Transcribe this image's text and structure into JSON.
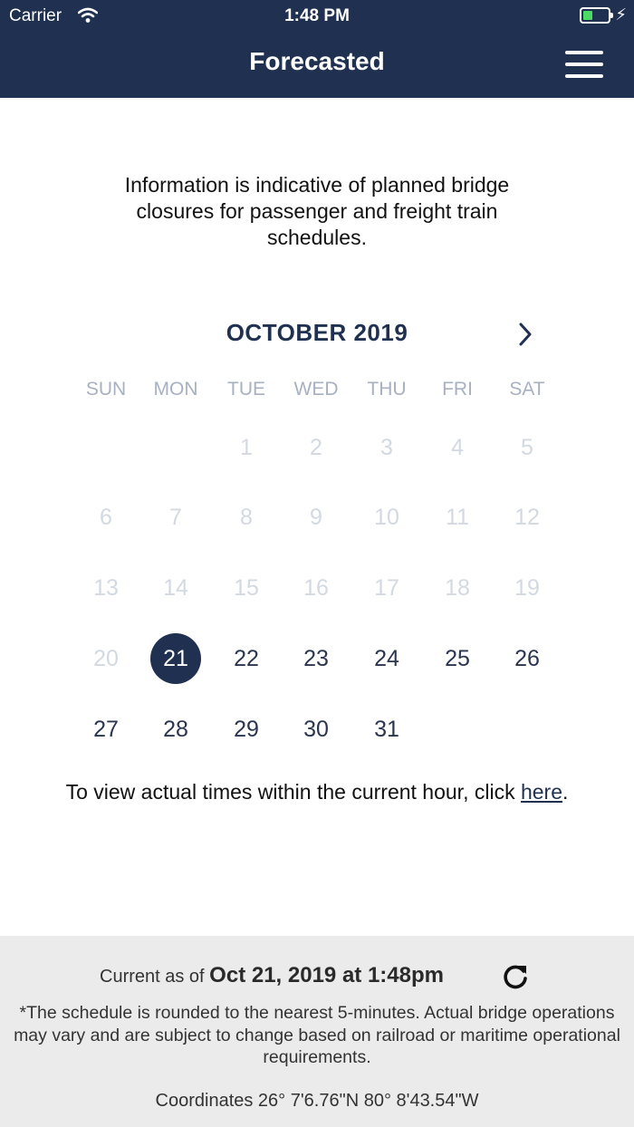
{
  "status_bar": {
    "carrier": "Carrier",
    "time": "1:48 PM",
    "battery_color": "#4cd964"
  },
  "header": {
    "title": "Forecasted",
    "menu_icon": "hamburger-menu-icon",
    "background": "#1f3050"
  },
  "info_text": "Information is indicative of planned bridge closures for passenger and freight train schedules.",
  "calendar": {
    "month_label": "OCTOBER 2019",
    "next_icon": "chevron-right-icon",
    "weekdays": [
      "SUN",
      "MON",
      "TUE",
      "WED",
      "THU",
      "FRI",
      "SAT"
    ],
    "first_weekday_index": 2,
    "days_in_month": 31,
    "selected_day": 21,
    "first_available_day": 21
  },
  "note": {
    "prefix": "To view actual times within the current hour, click ",
    "link": "here",
    "suffix": "."
  },
  "footer": {
    "current_prefix": "Current as of ",
    "current_value": "Oct 21, 2019 at 1:48pm",
    "refresh_icon": "refresh-icon",
    "disclaimer": "*The schedule is rounded to the nearest 5-minutes. Actual bridge operations may vary and are subject to change based on railroad or maritime operational requirements.",
    "coordinates": "Coordinates 26° 7'6.76\"N 80° 8'43.54\"W"
  }
}
